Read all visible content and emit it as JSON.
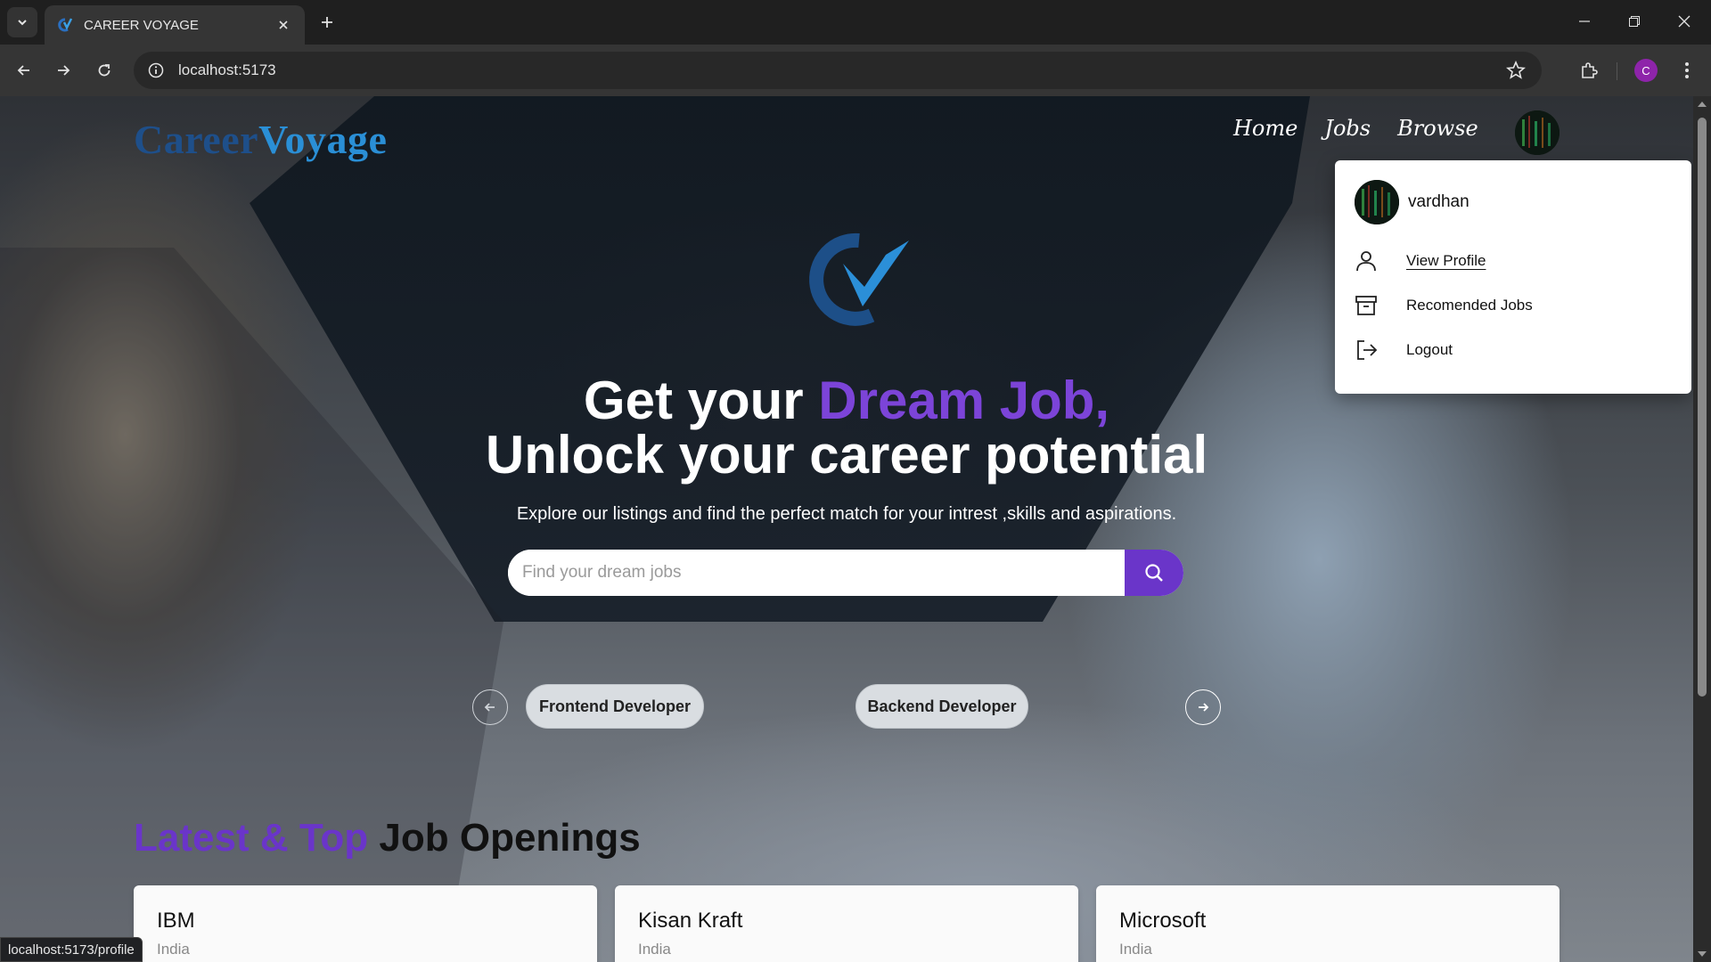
{
  "browser": {
    "tab_title": "CAREER VOYAGE",
    "url": "localhost:5173",
    "profile_initial": "C",
    "status_url": "localhost:5173/profile"
  },
  "navbar": {
    "logo_part1": "Career",
    "logo_part2": "Voyage",
    "links": [
      "Home",
      "Jobs",
      "Browse"
    ]
  },
  "dropdown": {
    "username": "vardhan",
    "items": [
      {
        "label": "View Profile",
        "icon": "user-icon"
      },
      {
        "label": "Recomended Jobs",
        "icon": "archive-icon"
      },
      {
        "label": "Logout",
        "icon": "logout-icon"
      }
    ]
  },
  "hero": {
    "line1_plain": "Get your ",
    "line1_accent": "Dream Job,",
    "line2": "Unlock your career potential",
    "subtitle": "Explore our listings and find the perfect match for your intrest ,skills and aspirations.",
    "search_placeholder": "Find your dream jobs"
  },
  "carousel": {
    "chips": [
      "Frontend Developer",
      "Backend Developer"
    ]
  },
  "latest": {
    "title_accent": "Latest & Top",
    "title_plain": " Job Openings",
    "jobs": [
      {
        "company": "IBM",
        "location": "India"
      },
      {
        "company": "Kisan Kraft",
        "location": "India"
      },
      {
        "company": "Microsoft",
        "location": "India"
      }
    ]
  },
  "colors": {
    "accent_purple": "#6a35c9",
    "logo_dark_blue": "#1e4f8a",
    "logo_light_blue": "#2a8fd6",
    "profile_purple": "#8e24aa"
  }
}
